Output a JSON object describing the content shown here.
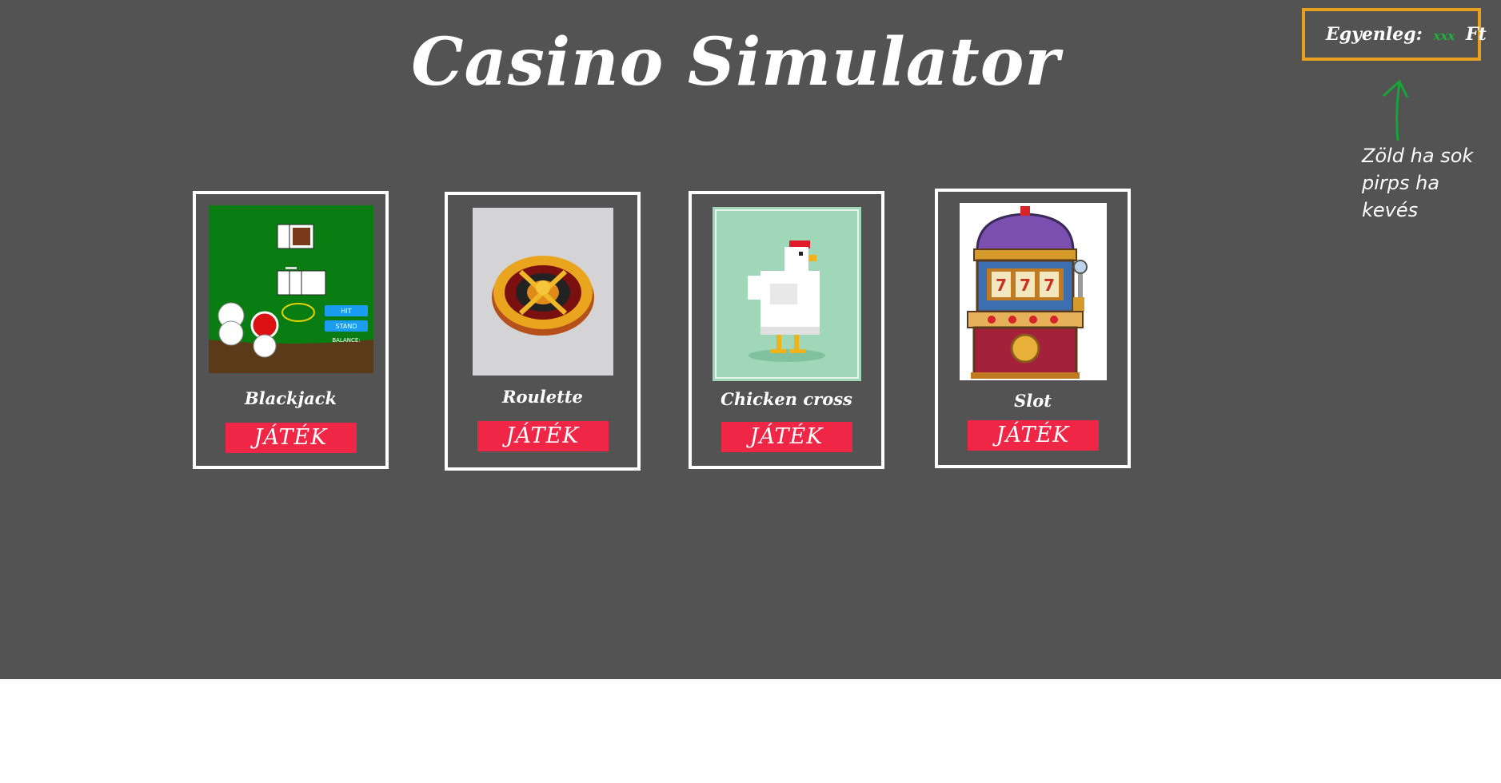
{
  "header": {
    "title": "Casino Simulator"
  },
  "balance": {
    "label": "Egyenleg:",
    "amount": "xxx",
    "currency": "Ft"
  },
  "annotation": {
    "line1": "Zöld ha sok",
    "line2": "pirps ha kevés"
  },
  "games": [
    {
      "name": "Blackjack",
      "button": "JÁTÉK",
      "icon": "blackjack-table"
    },
    {
      "name": "Roulette",
      "button": "JÁTÉK",
      "icon": "roulette-wheel"
    },
    {
      "name": "Chicken cross",
      "button": "JÁTÉK",
      "icon": "chicken"
    },
    {
      "name": "Slot",
      "button": "JÁTÉK",
      "icon": "slot-machine"
    }
  ],
  "blackjack_thumb": {
    "hit": "HIT",
    "stand": "STAND",
    "balance": "BALANCE:"
  },
  "slot_thumb": {
    "reels": [
      "7",
      "7",
      "7"
    ]
  },
  "colors": {
    "background": "#535353",
    "balance_border": "#e8a020",
    "balance_amount": "#1db43a",
    "play_button": "#ef2645",
    "annotation_arrow": "#1aa33a"
  }
}
